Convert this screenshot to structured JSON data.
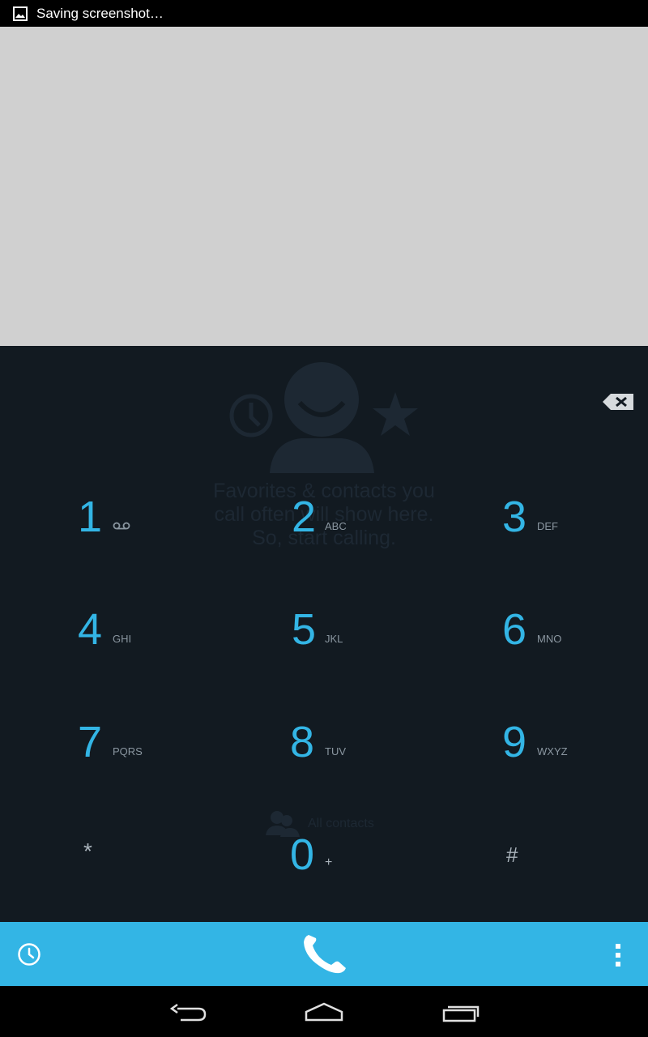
{
  "status_bar": {
    "notification_text": "Saving screenshot…",
    "notification_icon": "image-icon"
  },
  "empty_state": {
    "message_lines": [
      "Favorites & contacts you",
      "call often will show here.",
      "So, start calling."
    ],
    "all_contacts_label": "All contacts"
  },
  "keypad": {
    "keys": [
      {
        "digit": "1",
        "letters": "",
        "icon": "voicemail-icon"
      },
      {
        "digit": "2",
        "letters": "ABC"
      },
      {
        "digit": "3",
        "letters": "DEF"
      },
      {
        "digit": "4",
        "letters": "GHI"
      },
      {
        "digit": "5",
        "letters": "JKL"
      },
      {
        "digit": "6",
        "letters": "MNO"
      },
      {
        "digit": "7",
        "letters": "PQRS"
      },
      {
        "digit": "8",
        "letters": "TUV"
      },
      {
        "digit": "9",
        "letters": "WXYZ"
      },
      {
        "digit": "*",
        "letters": ""
      },
      {
        "digit": "0",
        "letters": "+"
      },
      {
        "digit": "#",
        "letters": ""
      }
    ]
  },
  "bottom_bar": {
    "left_icon": "call-history-icon",
    "center_icon": "phone-call-icon",
    "right_icon": "overflow-menu-icon"
  },
  "colors": {
    "accent": "#33b5e5",
    "dialer_bg": "#121a21",
    "placeholder_bg": "#d0d0d0"
  }
}
